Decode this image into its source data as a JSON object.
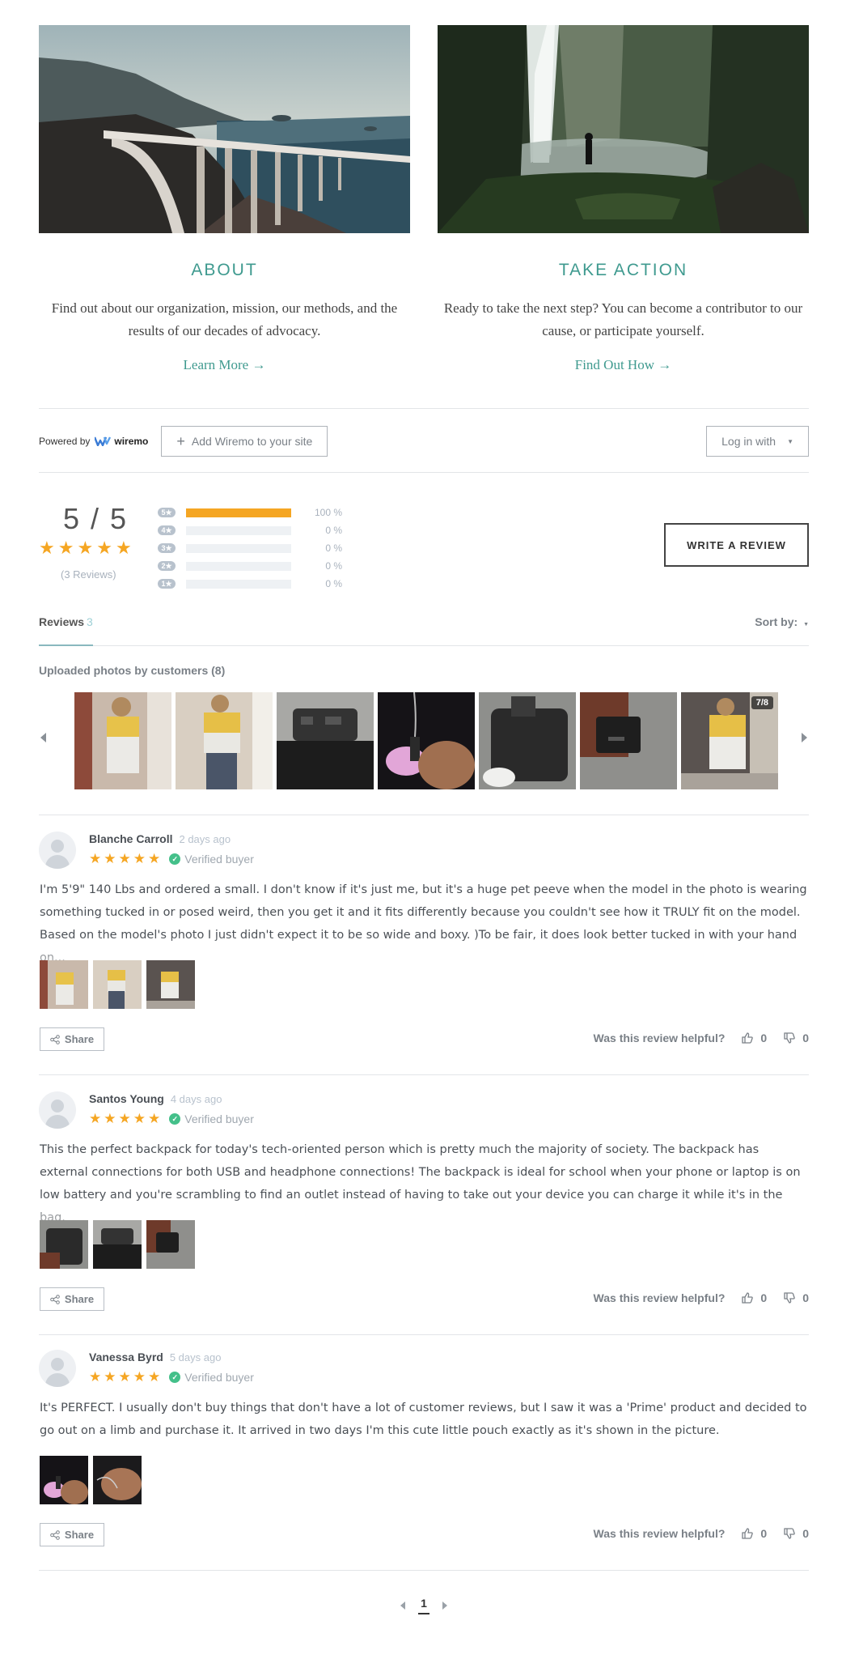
{
  "cards": [
    {
      "title": "ABOUT",
      "text": "Find out about our organization, mission, our methods, and the results of our decades of advocacy.",
      "link": "Learn More →"
    },
    {
      "title": "TAKE ACTION",
      "text": "Ready to take the next step? You can become a contributor to our cause, or participate yourself.",
      "link": "Find Out How →"
    }
  ],
  "powered": {
    "prefix": "Powered by",
    "brand": "wiremo",
    "add_button": "Add Wiremo to your site",
    "login_button": "Log in with"
  },
  "summary": {
    "score": "5 / 5",
    "stars": 5,
    "count_label": "(3 Reviews)",
    "write_button": "WRITE A REVIEW",
    "bars": [
      {
        "stars": "5★",
        "fraction": 1.0,
        "pct": "100 %"
      },
      {
        "stars": "4★",
        "fraction": 0,
        "pct": "0 %"
      },
      {
        "stars": "3★",
        "fraction": 0,
        "pct": "0 %"
      },
      {
        "stars": "2★",
        "fraction": 0,
        "pct": "0 %"
      },
      {
        "stars": "1★",
        "fraction": 0,
        "pct": "0 %"
      }
    ],
    "accent": "#f5a623"
  },
  "tabs": {
    "reviews_label": "Reviews",
    "reviews_count": "3",
    "sort_label": "Sort by:"
  },
  "photos": {
    "label": "Uploaded photos by customers (8)",
    "counter": "7/8"
  },
  "reviews": [
    {
      "name": "Blanche Carroll",
      "date": "2 days ago",
      "stars": 5,
      "verified": "Verified buyer",
      "text": "I'm 5'9\" 140 Lbs and ordered a small. I don't know if it's just me, but it's a huge pet peeve when the model in the photo is wearing something tucked in or posed weird, then you get it and it fits differently because you couldn't see how it TRULY fit on the model. Based on the model's photo I just didn't expect it to be so wide and boxy. )To be fair, it does look better tucked in with your hand on...",
      "share": "Share",
      "helpful": "Was this review helpful?",
      "up": "0",
      "down": "0"
    },
    {
      "name": "Santos Young",
      "date": "4 days ago",
      "stars": 5,
      "verified": "Verified buyer",
      "text": "This the perfect backpack for today's tech-oriented person which is pretty much the majority of society. The backpack has external connections for both USB and headphone connections! The backpack is ideal for school when your phone or laptop is on low battery and you're scrambling to find an outlet instead of having to take out your device you can charge it while it's in the bag.",
      "share": "Share",
      "helpful": "Was this review helpful?",
      "up": "0",
      "down": "0"
    },
    {
      "name": "Vanessa Byrd",
      "date": "5 days ago",
      "stars": 5,
      "verified": "Verified buyer",
      "text": "It's PERFECT. I usually don't buy things that don't have a lot of customer reviews, but I saw it was a 'Prime' product and decided to go out on a limb and purchase it. It arrived in two days I'm this cute little pouch exactly as it's shown in the picture.",
      "share": "Share",
      "helpful": "Was this review helpful?",
      "up": "0",
      "down": "0"
    }
  ],
  "pagination": {
    "current": "1"
  }
}
